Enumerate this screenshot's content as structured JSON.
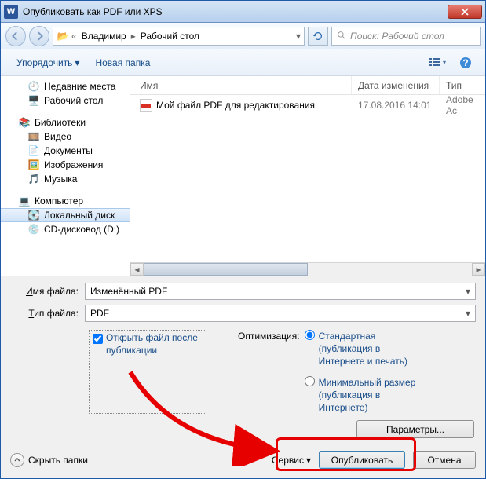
{
  "title": "Опубликовать как PDF или XPS",
  "breadcrumb": {
    "folder_icon": "📂",
    "seg1": "Владимир",
    "seg2": "Рабочий стол"
  },
  "search": {
    "placeholder": "Поиск: Рабочий стол"
  },
  "toolbar": {
    "organize": "Упорядочить",
    "new_folder": "Новая папка"
  },
  "sidebar": {
    "recent": "Недавние места",
    "desktop": "Рабочий стол",
    "libraries": "Библиотеки",
    "videos": "Видео",
    "documents": "Документы",
    "pictures": "Изображения",
    "music": "Музыка",
    "computer": "Компьютер",
    "localdisk": "Локальный диск",
    "cddrive": "CD-дисковод (D:)"
  },
  "columns": {
    "name": "Имя",
    "date": "Дата изменения",
    "type": "Тип"
  },
  "files": [
    {
      "name": "Мой файл PDF для редактирования",
      "date": "17.08.2016 14:01",
      "type": "Adobe Ac"
    }
  ],
  "form": {
    "filename_label": "Имя файла:",
    "filename_value": "Изменённый PDF",
    "filetype_label": "Тип файла:",
    "filetype_value": "PDF",
    "open_after": "Открыть файл после публикации",
    "optimization": "Оптимизация:",
    "radio_standard": "Стандартная (публикация в Интернете и печать)",
    "radio_minimal": "Минимальный размер (публикация в Интернете)",
    "parameters": "Параметры..."
  },
  "footer": {
    "hide_folders": "Скрыть папки",
    "service": "Сервис",
    "publish": "Опубликовать",
    "cancel": "Отмена"
  }
}
